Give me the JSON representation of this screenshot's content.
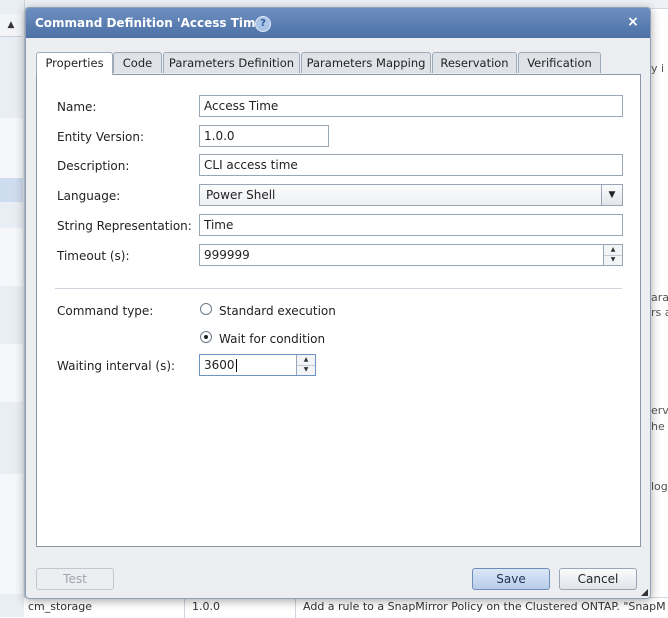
{
  "dialog": {
    "title": "Command Definition 'Access Time'",
    "help_icon": "?",
    "close_icon": "×"
  },
  "tabs": [
    {
      "label": "Properties",
      "active": true
    },
    {
      "label": "Code",
      "active": false
    },
    {
      "label": "Parameters Definition",
      "active": false
    },
    {
      "label": "Parameters Mapping",
      "active": false
    },
    {
      "label": "Reservation",
      "active": false
    },
    {
      "label": "Verification",
      "active": false
    }
  ],
  "form": {
    "name_label": "Name:",
    "name_value": "Access Time",
    "entity_version_label": "Entity Version:",
    "entity_version_value": "1.0.0",
    "description_label": "Description:",
    "description_value": "CLI access time",
    "language_label": "Language:",
    "language_value": "Power Shell",
    "string_rep_label": "String Representation:",
    "string_rep_value": "Time",
    "timeout_label": "Timeout (s):",
    "timeout_value": "999999",
    "command_type_label": "Command type:",
    "radio_standard": "Standard execution",
    "radio_wait": "Wait for condition",
    "command_type_selected": "Wait for condition",
    "waiting_interval_label": "Waiting interval (s):",
    "waiting_interval_value": "3600"
  },
  "footer": {
    "test_label": "Test",
    "save_label": "Save",
    "cancel_label": "Cancel"
  },
  "background": {
    "scroll_up_glyph": "▲",
    "right_snippets": [
      "y i",
      "ara",
      "rs a",
      "erv",
      "he i",
      "log"
    ],
    "bottom_row": {
      "col1": "cm_storage",
      "col2": "1.0.0",
      "col3": "Add a rule to a SnapMirror Policy on the Clustered ONTAP. \"SnapM"
    }
  },
  "icons": {
    "combo_arrow": "▼",
    "spin_up": "▲",
    "spin_down": "▼"
  }
}
